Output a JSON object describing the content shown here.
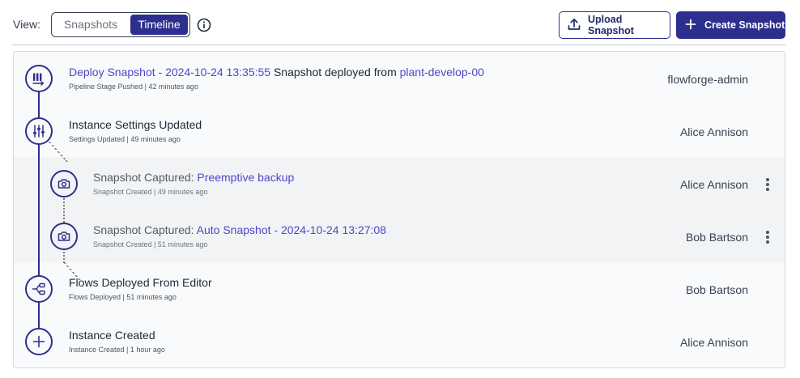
{
  "toolbar": {
    "view_label": "View:",
    "toggle": {
      "snapshots": "Snapshots",
      "timeline": "Timeline",
      "active": "Timeline"
    },
    "info_icon": "info-circle-icon",
    "upload_label": "Upload Snapshot",
    "create_label": "Create Snapshot"
  },
  "colors": {
    "accent": "#2d2f8e",
    "link": "#4f46c8",
    "nested_bg": "#f2f3f5"
  },
  "timeline": {
    "events": [
      {
        "icon": "pipeline-icon",
        "title_link": "Deploy Snapshot - 2024-10-24 13:35:55",
        "title_text": " Snapshot deployed from ",
        "title_link2": "plant-develop-00",
        "meta": "Pipeline Stage Pushed | 42 minutes ago",
        "user": "flowforge-admin"
      },
      {
        "icon": "settings-sliders-icon",
        "title_text": "Instance Settings Updated",
        "meta": "Settings Updated | 49 minutes ago",
        "user": "Alice Annison"
      },
      {
        "icon": "camera-icon",
        "title_text": "Snapshot Captured: ",
        "title_link": "Preemptive backup",
        "meta": "Snapshot Created | 49 minutes ago",
        "user": "Alice Annison"
      },
      {
        "icon": "camera-icon",
        "title_text": "Snapshot Captured: ",
        "title_link": "Auto Snapshot - 2024-10-24 13:27:08",
        "meta": "Snapshot Created | 51 minutes ago",
        "user": "Bob Bartson"
      },
      {
        "icon": "flows-icon",
        "title_text": "Flows Deployed From Editor",
        "meta": "Flows Deployed | 51 minutes ago",
        "user": "Bob Bartson"
      },
      {
        "icon": "plus-icon",
        "title_text": "Instance Created",
        "meta": "Instance Created | 1 hour ago",
        "user": "Alice Annison"
      }
    ]
  }
}
